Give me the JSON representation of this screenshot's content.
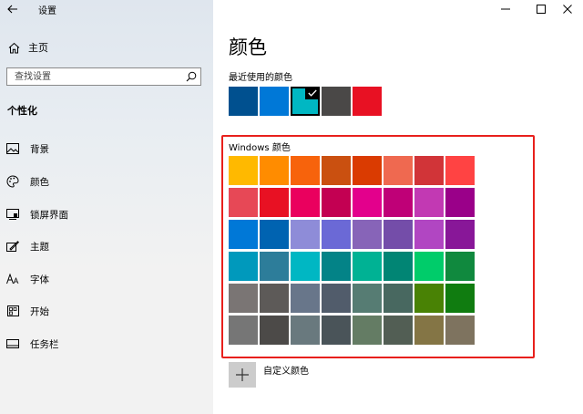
{
  "app_title": "设置",
  "sidebar": {
    "home_label": "主页",
    "search_placeholder": "查找设置",
    "section_title": "个性化",
    "items": [
      {
        "label": "背景",
        "icon": "picture-icon"
      },
      {
        "label": "颜色",
        "icon": "palette-icon"
      },
      {
        "label": "锁屏界面",
        "icon": "lock-screen-icon"
      },
      {
        "label": "主题",
        "icon": "theme-icon"
      },
      {
        "label": "字体",
        "icon": "font-icon"
      },
      {
        "label": "开始",
        "icon": "start-icon"
      },
      {
        "label": "任务栏",
        "icon": "taskbar-icon"
      }
    ]
  },
  "main": {
    "title": "颜色",
    "recent_label": "最近使用的颜色",
    "recent_colors": [
      "#00508f",
      "#0078d7",
      "#00b7c3",
      "#4a4847",
      "#e81123"
    ],
    "recent_selected_index": 2,
    "windows_colors_label": "Windows 颜色",
    "windows_colors": [
      [
        "#ffb900",
        "#ff8c00",
        "#f7630c",
        "#ca5010",
        "#da3b01",
        "#ef6950",
        "#d13438",
        "#ff4343"
      ],
      [
        "#e74856",
        "#e81123",
        "#ea005e",
        "#c30052",
        "#e3008c",
        "#bf0077",
        "#c239b3",
        "#9a0089"
      ],
      [
        "#0078d7",
        "#0063b1",
        "#8e8cd8",
        "#6b69d6",
        "#8764b8",
        "#744da9",
        "#b146c2",
        "#881798"
      ],
      [
        "#0099bc",
        "#2d7d9a",
        "#00b7c3",
        "#038387",
        "#00b294",
        "#018574",
        "#00cc6a",
        "#10893e"
      ],
      [
        "#7a7574",
        "#5d5a58",
        "#68768a",
        "#515c6b",
        "#567c73",
        "#486860",
        "#498205",
        "#107c10"
      ],
      [
        "#767676",
        "#4c4a48",
        "#69797e",
        "#4a5459",
        "#647c64",
        "#525e54",
        "#847545",
        "#7e735f"
      ]
    ],
    "custom_color_label": "自定义颜色"
  },
  "accent_colors": {
    "highlight_border": "#e8201c"
  }
}
